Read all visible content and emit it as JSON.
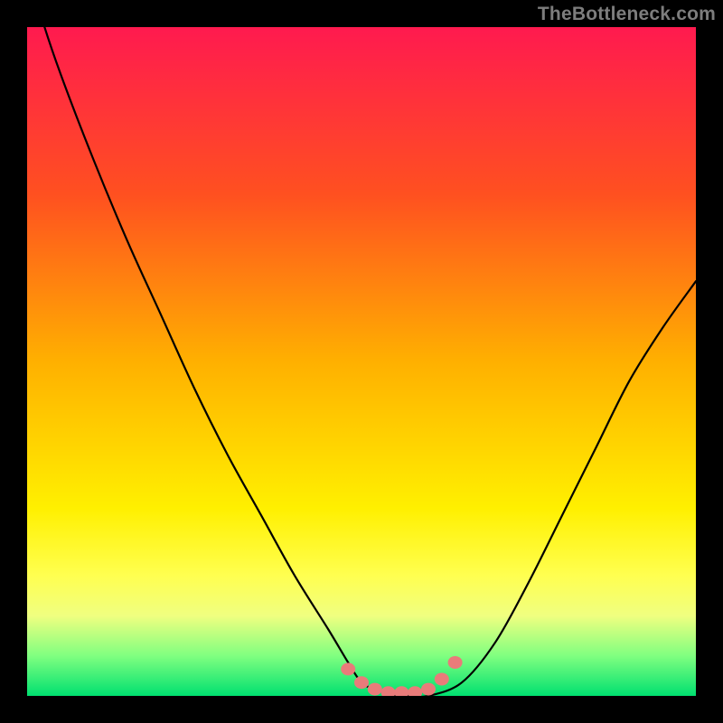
{
  "watermark": "TheBottleneck.com",
  "colors": {
    "frame": "#000000",
    "curve": "#000000",
    "marker": "#e97b7a",
    "gradient_stops": [
      "#ff1a4f",
      "#ff5020",
      "#ffb000",
      "#fff000",
      "#ffff50",
      "#f0ff80",
      "#80ff80",
      "#00e070"
    ]
  },
  "chart_data": {
    "type": "line",
    "title": "",
    "xlabel": "",
    "ylabel": "",
    "xlim": [
      0,
      100
    ],
    "ylim": [
      0,
      100
    ],
    "x": [
      0,
      2,
      5,
      10,
      15,
      20,
      25,
      30,
      35,
      40,
      45,
      48,
      50,
      52,
      55,
      57,
      60,
      65,
      70,
      75,
      80,
      85,
      90,
      95,
      100
    ],
    "values": [
      110,
      102,
      93,
      80,
      68,
      57,
      46,
      36,
      27,
      18,
      10,
      5,
      2,
      1,
      0,
      0,
      0,
      2,
      8,
      17,
      27,
      37,
      47,
      55,
      62
    ],
    "markers": {
      "x": [
        48,
        50,
        52,
        54,
        56,
        58,
        60,
        62,
        64
      ],
      "y": [
        4,
        2,
        1,
        0.5,
        0.5,
        0.5,
        1,
        2.5,
        5
      ]
    },
    "note": "x in percent of horizontal plot width; values as percent up from bottom of plot (0=bottom green edge, 100=top red edge). Left branch starts above top (clipped)."
  }
}
